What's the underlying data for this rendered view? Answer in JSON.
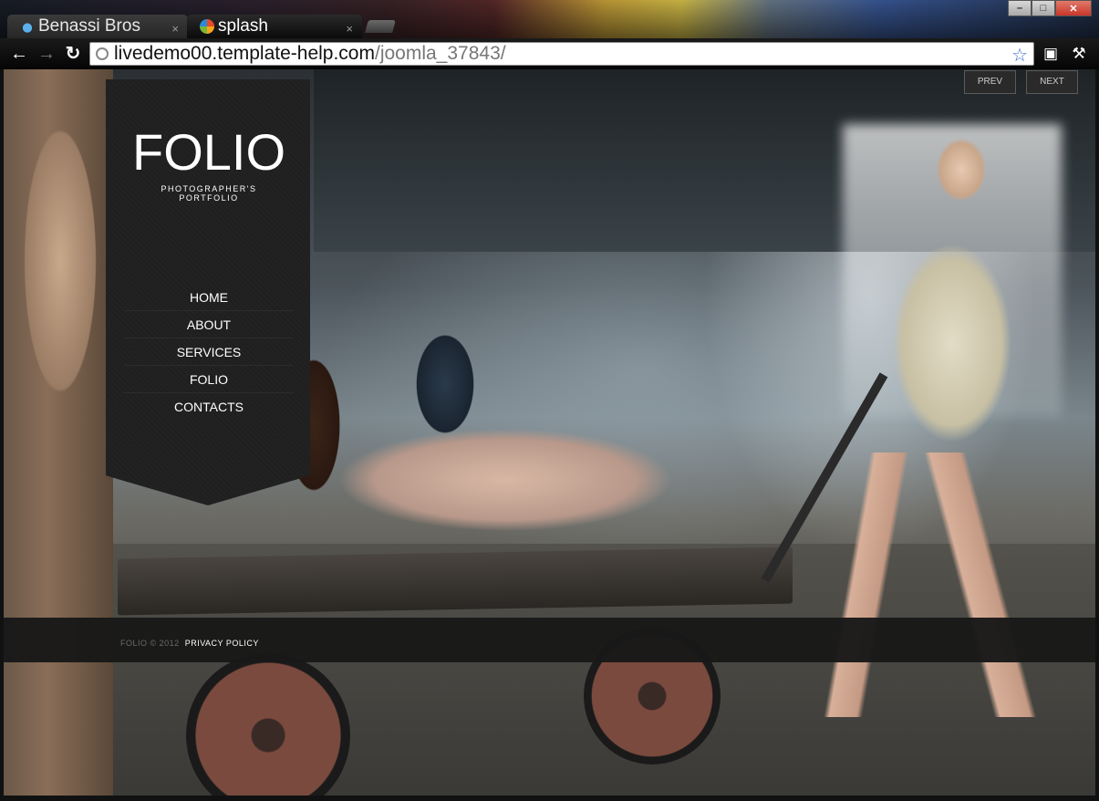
{
  "browser": {
    "tabs": [
      {
        "title": "Benassi Bros",
        "active": false
      },
      {
        "title": "splash",
        "active": true
      }
    ],
    "tab_close": "×",
    "url_host": "livedemo00.template-help.com",
    "url_path": "/joomla_37843/",
    "window_buttons": {
      "minimize": "–",
      "maximize": "□",
      "close": "✕"
    }
  },
  "site": {
    "logo": "FOLIO",
    "tagline": "PHOTOGRAPHER'S PORTFOLIO",
    "menu": [
      "HOME",
      "ABOUT",
      "SERVICES",
      "FOLIO",
      "CONTACTS"
    ],
    "slider": {
      "prev": "PREV",
      "next": "NEXT"
    },
    "footer": {
      "copyright": "FOLIO © 2012",
      "privacy": "PRIVACY POLICY"
    }
  },
  "colors": {
    "sidebar": "#1f1f1f",
    "footer": "#181818",
    "link_active": "#ffffff"
  }
}
